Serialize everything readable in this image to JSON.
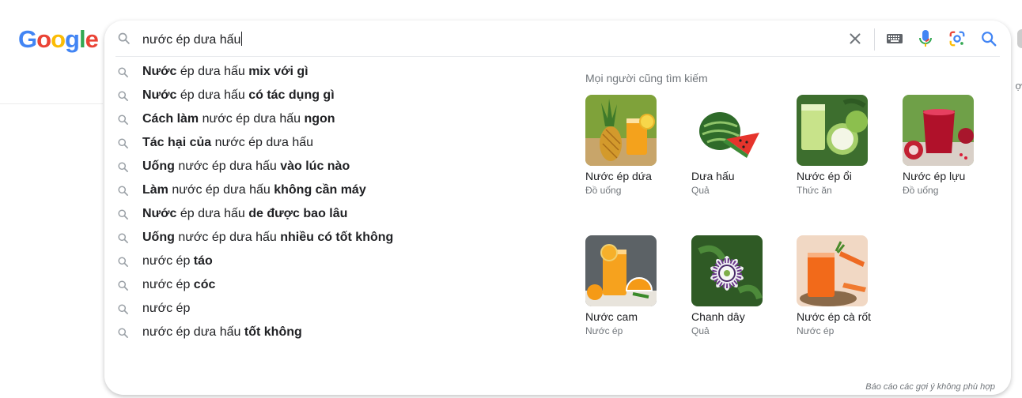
{
  "logo": [
    "G",
    "o",
    "o",
    "g",
    "l",
    "e"
  ],
  "right_edge_text": "ợ",
  "search": {
    "query": "nước ép dưa hấu"
  },
  "suggestions": [
    {
      "parts": [
        {
          "t": "Nước",
          "b": true
        },
        {
          "t": " ép dưa hấu ",
          "b": false
        },
        {
          "t": "mix với gì",
          "b": true
        }
      ]
    },
    {
      "parts": [
        {
          "t": "Nước",
          "b": true
        },
        {
          "t": " ép dưa hấu ",
          "b": false
        },
        {
          "t": "có tác dụng gì",
          "b": true
        }
      ]
    },
    {
      "parts": [
        {
          "t": "Cách làm",
          "b": true
        },
        {
          "t": " nước ép dưa hấu ",
          "b": false
        },
        {
          "t": "ngon",
          "b": true
        }
      ]
    },
    {
      "parts": [
        {
          "t": "Tác hại của",
          "b": true
        },
        {
          "t": " nước ép dưa hấu",
          "b": false
        }
      ]
    },
    {
      "parts": [
        {
          "t": "Uống",
          "b": true
        },
        {
          "t": " nước ép dưa hấu ",
          "b": false
        },
        {
          "t": "vào lúc nào",
          "b": true
        }
      ]
    },
    {
      "parts": [
        {
          "t": "Làm",
          "b": true
        },
        {
          "t": " nước ép dưa hấu ",
          "b": false
        },
        {
          "t": "không cần máy",
          "b": true
        }
      ]
    },
    {
      "parts": [
        {
          "t": "Nước",
          "b": true
        },
        {
          "t": " ép dưa hấu ",
          "b": false
        },
        {
          "t": "de được bao lâu",
          "b": true
        }
      ]
    },
    {
      "parts": [
        {
          "t": "Uống",
          "b": true
        },
        {
          "t": " nước ép dưa hấu ",
          "b": false
        },
        {
          "t": "nhiều có tốt không",
          "b": true
        }
      ]
    },
    {
      "parts": [
        {
          "t": "nước ép ",
          "b": false
        },
        {
          "t": "táo",
          "b": true
        }
      ]
    },
    {
      "parts": [
        {
          "t": "nước ép ",
          "b": false
        },
        {
          "t": "cóc",
          "b": true
        }
      ]
    },
    {
      "parts": [
        {
          "t": "nước ép",
          "b": false
        }
      ]
    },
    {
      "parts": [
        {
          "t": "nước ép dưa hấu ",
          "b": false
        },
        {
          "t": "tốt không",
          "b": true
        }
      ]
    }
  ],
  "people_also_search": {
    "title": "Mọi người cũng tìm kiếm",
    "items": [
      {
        "name": "Nước ép dứa",
        "sub": "Đồ uống",
        "img": "pineapple-juice"
      },
      {
        "name": "Dưa hấu",
        "sub": "Quả",
        "img": "watermelon"
      },
      {
        "name": "Nước ép ổi",
        "sub": "Thức ăn",
        "img": "guava-juice"
      },
      {
        "name": "Nước ép lựu",
        "sub": "Đồ uống",
        "img": "pomegranate-juice"
      },
      {
        "name": "Nước cam",
        "sub": "Nước ép",
        "img": "orange-juice"
      },
      {
        "name": "Chanh dây",
        "sub": "Quả",
        "img": "passion-flower"
      },
      {
        "name": "Nước ép cà rốt",
        "sub": "Nước ép",
        "img": "carrot-juice"
      }
    ]
  },
  "footer_note": "Báo cáo các gợi ý không phù hợp",
  "colors": {
    "accent": "#4285f4",
    "text": "#202124",
    "muted": "#70757a"
  }
}
